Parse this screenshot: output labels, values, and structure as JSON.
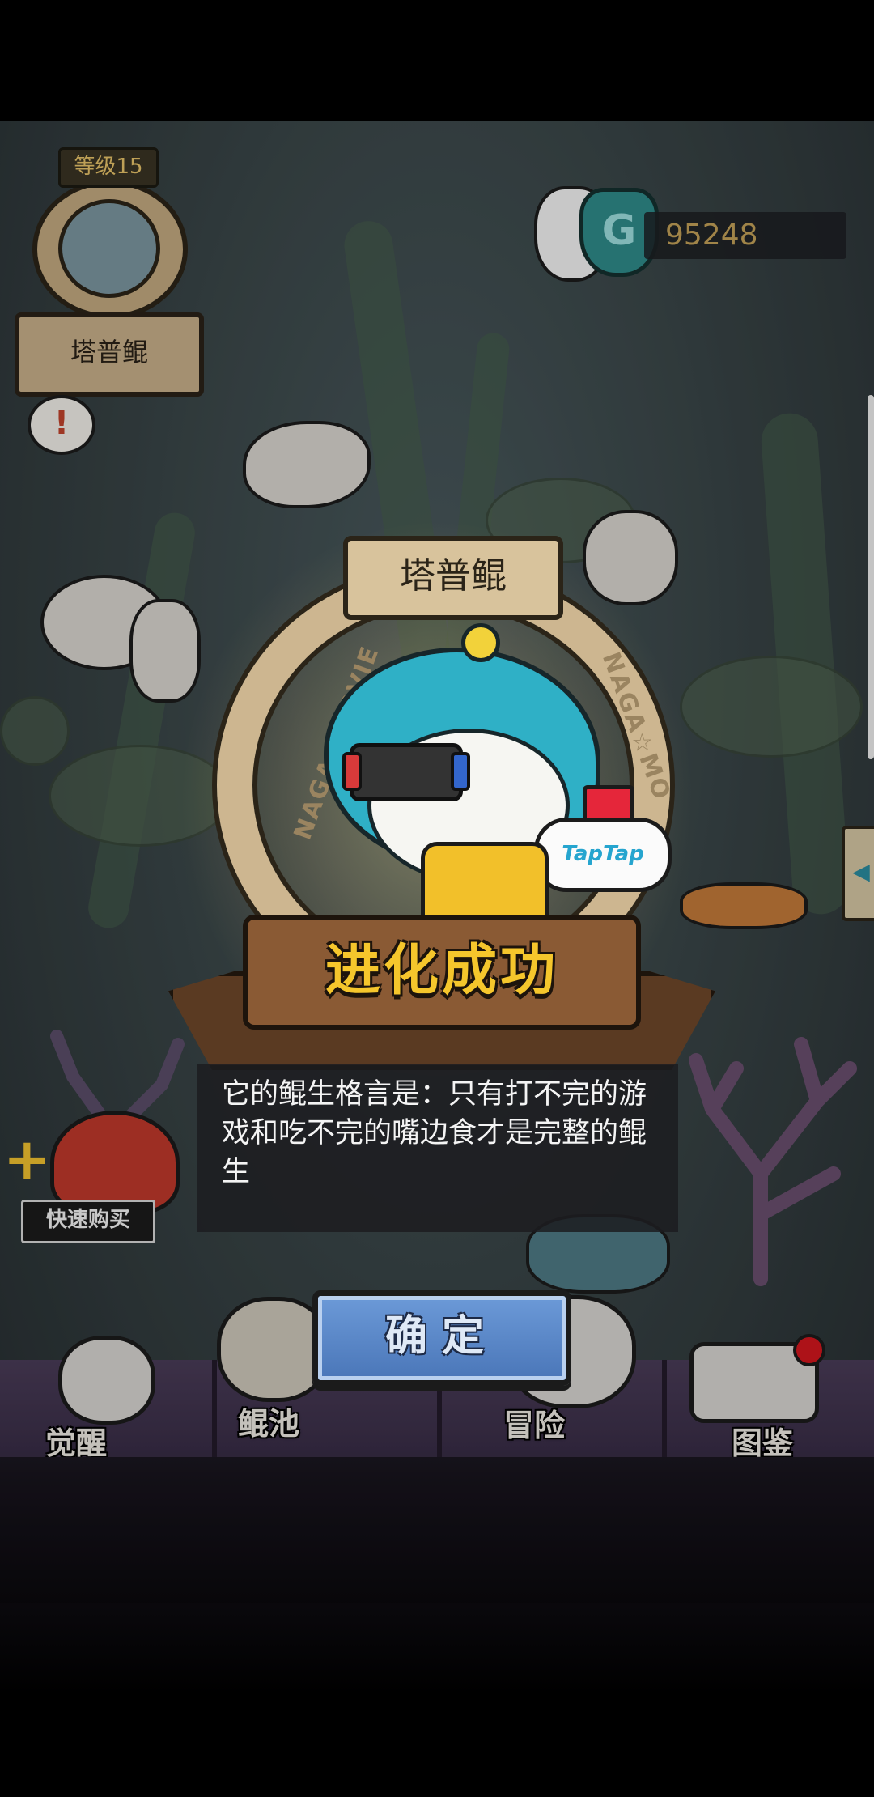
{
  "hud": {
    "level_label": "等级15",
    "pet_name": "塔普鲲",
    "currency_amount": "95248",
    "currency_icon": "g-coin-icon",
    "alert_icon": "exclamation-bubble-icon"
  },
  "quick_buy": {
    "label": "快速购买"
  },
  "bottom_nav": {
    "items": [
      {
        "label": "觉醒",
        "icon": "awaken-icon"
      },
      {
        "label": "鲲池",
        "icon": "pond-icon"
      },
      {
        "label": "冒险",
        "icon": "adventure-icon"
      },
      {
        "label": "图鉴",
        "icon": "collection-icon"
      }
    ]
  },
  "modal": {
    "pet_name": "塔普鲲",
    "banner": "进化成功",
    "frame_text_left": "NAGA☆MOVIE",
    "frame_text_right": "NAGA☆MO",
    "badge_text": "TapTap",
    "motto": "它的鲲生格言是：只有打不完的游戏和吃不完的嘴边食才是完整的鲲生",
    "confirm_label": "确定"
  },
  "colors": {
    "banner_text": "#f5c62c",
    "confirm_button": "#5a86c8",
    "currency_text": "#c4a158"
  }
}
